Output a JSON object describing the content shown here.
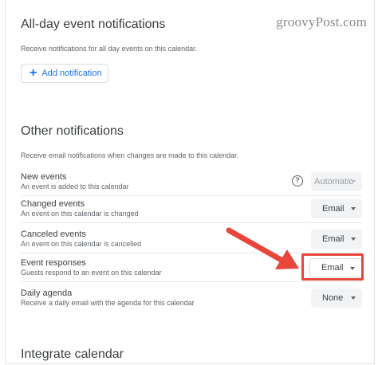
{
  "watermark": "groovyPost.com",
  "allday": {
    "title": "All-day event notifications",
    "subtitle": "Receive notifications for all day events on this calendar.",
    "add_button": "Add notification"
  },
  "other": {
    "title": "Other notifications",
    "subtitle": "Receive email notifications when changes are made to this calendar.",
    "rows": [
      {
        "label": "New events",
        "desc": "An event is added to this calendar",
        "value": "Automatic"
      },
      {
        "label": "Changed events",
        "desc": "An event on this calendar is changed",
        "value": "Email"
      },
      {
        "label": "Canceled events",
        "desc": "An event on this calendar is cancelled",
        "value": "Email"
      },
      {
        "label": "Event responses",
        "desc": "Guests respond to an event on this calendar",
        "value": "Email"
      },
      {
        "label": "Daily agenda",
        "desc": "Receive a daily email with the agenda for this calendar",
        "value": "None"
      }
    ]
  },
  "integrate": {
    "title": "Integrate calendar"
  },
  "icons": {
    "help": "help-circle-icon",
    "add": "plus-icon",
    "caret": "caret-down-icon",
    "arrow": "annotation-arrow"
  },
  "colors": {
    "accent": "#1a73e8",
    "highlight": "#e8463b"
  }
}
